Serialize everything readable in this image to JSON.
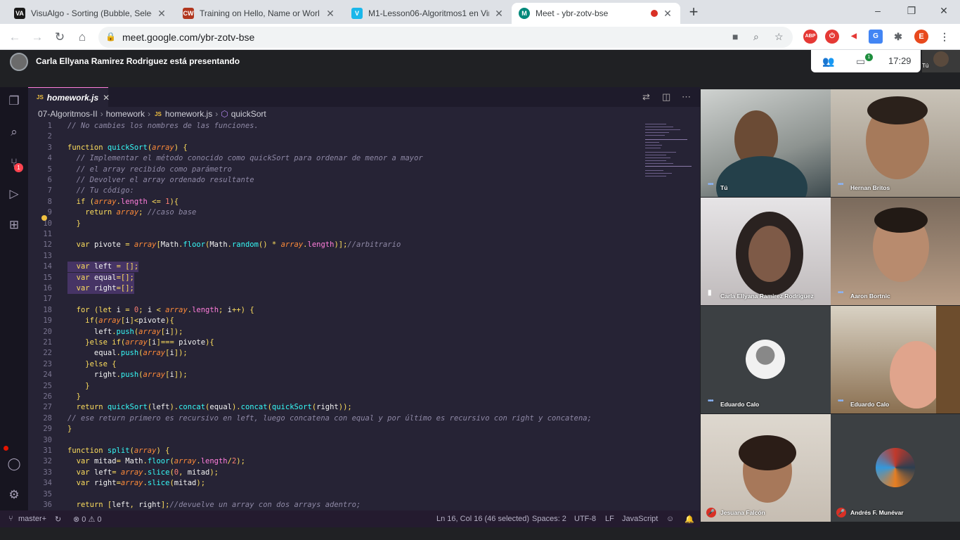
{
  "browser": {
    "tabs": [
      {
        "title": "VisuAlgo - Sorting (Bubble, Selec",
        "favicon": "VA"
      },
      {
        "title": "Training on Hello, Name or Worl",
        "favicon": "CW"
      },
      {
        "title": "M1-Lesson06-Algoritmos1 en Vir",
        "favicon": "V"
      },
      {
        "title": "Meet - ybr-zotv-bse",
        "favicon": "M"
      }
    ],
    "new_tab": "+",
    "window_controls": [
      "–",
      "❐",
      "✕"
    ],
    "url": "meet.google.com/ybr-zotv-bse",
    "profile_initial": "E",
    "abp_label": "ABP"
  },
  "meet": {
    "presenter_text": "Carla Ellyana Ramirez Rodriguez está presentando",
    "clock": "17:29",
    "chat_badge": "1",
    "self_label": "Tú",
    "participants": [
      {
        "name": "Tú",
        "state": "speaking"
      },
      {
        "name": "Hernan Britos",
        "state": "speaking"
      },
      {
        "name": "Carla Ellyana Ramirez Rodriguez",
        "state": "presenting"
      },
      {
        "name": "Aaron Bortnic",
        "state": "speaking"
      },
      {
        "name": "Eduardo Calo",
        "state": "speaking"
      },
      {
        "name": "Eduardo Calo",
        "state": "speaking"
      },
      {
        "name": "Jesuana Falcón",
        "state": "muted"
      },
      {
        "name": "Andrés F. Munévar",
        "state": "muted"
      }
    ]
  },
  "vscode": {
    "tab_title": "homework.js",
    "tab_icon": "JS",
    "breadcrumb": [
      "07-Algoritmos-II",
      "homework",
      "homework.js",
      "quickSort"
    ],
    "scm_badge": "1",
    "status": {
      "branch": "master+",
      "problems": "⊗ 0 ⚠ 0",
      "position": "Ln 16, Col 16 (46 selected)",
      "spaces": "Spaces: 2",
      "encoding": "UTF-8",
      "eol": "LF",
      "language": "JavaScript"
    },
    "lines": [
      "// No cambies los nombres de las funciones.",
      "",
      "function quickSort(array) {",
      "  // Implementar el método conocido como quickSort para ordenar de menor a mayor",
      "  // el array recibido como parámetro",
      "  // Devolver el array ordenado resultante",
      "  // Tu código:",
      "  if (array.length <= 1){",
      "    return array; //caso base",
      "  }",
      "",
      "  var pivote = array[Math.floor(Math.random() * array.length)];//arbitrario",
      "",
      "  var left = [];",
      "  var equal=[];",
      "  var right=[];",
      "",
      "  for (let i = 0; i < array.length; i++) {",
      "    if(array[i]<pivote){",
      "      left.push(array[i]);",
      "    }else if(array[i]=== pivote){",
      "      equal.push(array[i]);",
      "    }else {",
      "      right.push(array[i]);",
      "    }",
      "  }",
      "  return quickSort(left).concat(equal).concat(quickSort(right));",
      "// ese return primero es recursivo en left, luego concatena con equal y por último es recursivo con right y concatena;",
      "}",
      "",
      "function split(array) {",
      "  var mitad= Math.floor(array.length/2);",
      "  var left= array.slice(0, mitad);",
      "  var right=array.slice(mitad);",
      "",
      "  return [left, right];//devuelve un array con dos arrays adentro;"
    ]
  }
}
